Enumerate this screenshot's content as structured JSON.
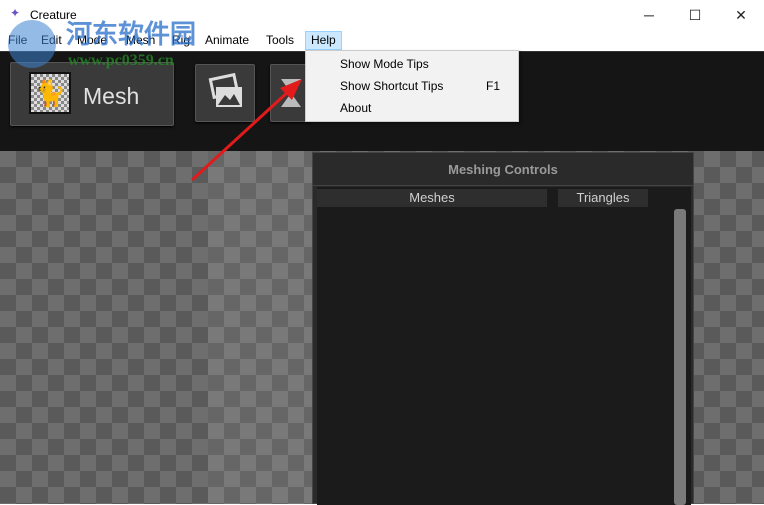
{
  "window": {
    "title": "Creature",
    "minimize": "─",
    "maximize": "☐",
    "close": "✕"
  },
  "menubar": [
    "File",
    "Edit",
    "Mode",
    "Mesh",
    "Rig",
    "Animate",
    "Tools",
    "Help"
  ],
  "help_menu": [
    {
      "label": "Show Mode Tips",
      "shortcut": ""
    },
    {
      "label": "Show Shortcut Tips",
      "shortcut": "F1"
    },
    {
      "label": "About",
      "shortcut": ""
    }
  ],
  "toolbar": {
    "mode_label": "Mesh"
  },
  "panel": {
    "title": "Meshing Controls",
    "columns": [
      "Meshes",
      "Triangles"
    ]
  },
  "watermark": {
    "name": "河东软件园",
    "url": "www.pc0359.cn"
  },
  "colors": {
    "arrow": "#e11b1b",
    "menu_highlight": "#cce8ff"
  }
}
